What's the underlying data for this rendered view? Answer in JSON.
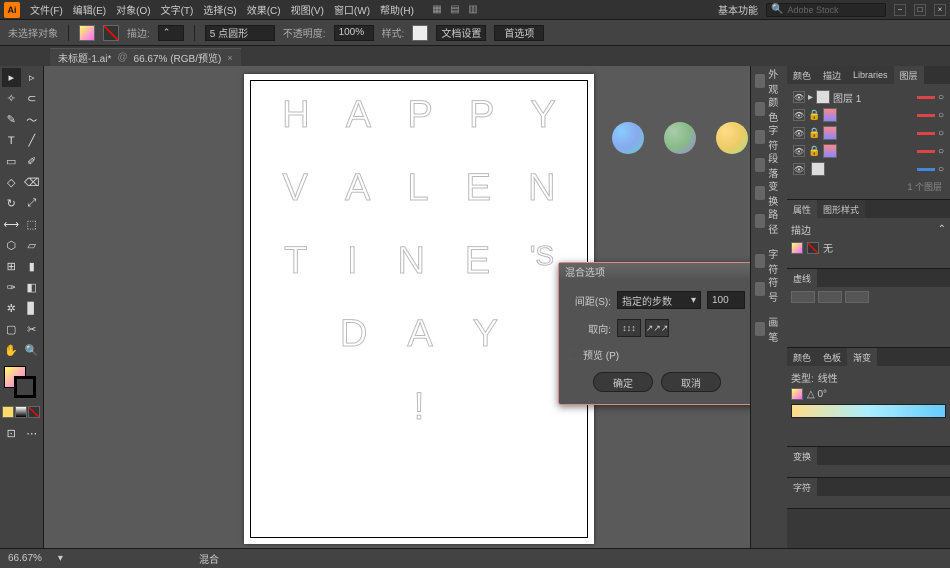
{
  "app": {
    "logo": "Ai",
    "search_placeholder": "Adobe Stock"
  },
  "menu": [
    "文件(F)",
    "编辑(E)",
    "对象(O)",
    "文字(T)",
    "选择(S)",
    "效果(C)",
    "视图(V)",
    "窗口(W)",
    "帮助(H)"
  ],
  "essentials": "基本功能",
  "control": {
    "no_selection": "未选择对象",
    "stroke_label": "描边:",
    "stroke_pt": "5 点圆形",
    "opacity_label": "不透明度:",
    "opacity": "100%",
    "style_label": "样式:",
    "docsetup": "文档设置",
    "prefs": "首选项"
  },
  "doc": {
    "tab": "未标题-1.ai*",
    "zoom": "66.67% (RGB/预览)"
  },
  "artboard": {
    "rows": [
      [
        "H",
        "A",
        "P",
        "P",
        "Y"
      ],
      [
        "V",
        "A",
        "L",
        "E",
        "N"
      ],
      [
        "T",
        "I",
        "N",
        "E",
        "'S"
      ],
      [
        "D",
        "A",
        "Y"
      ],
      [
        "!"
      ]
    ]
  },
  "dialog": {
    "title": "混合选项",
    "spacing_label": "间距(S):",
    "spacing_mode": "指定的步数",
    "steps": "100",
    "orient_label": "取向:",
    "preview": "预览 (P)",
    "ok": "确定",
    "cancel": "取消"
  },
  "dock_icons": [
    "外观",
    "颜色",
    "字符",
    "段落",
    "变换",
    "路径",
    "字符",
    "符号"
  ],
  "brush_label": "画笔",
  "panels": {
    "layers": {
      "tabs": [
        "颜色",
        "描边",
        "Libraries",
        "图层"
      ],
      "items": [
        {
          "name": "图层 1",
          "color": "red"
        },
        {
          "name": "",
          "color": "red"
        },
        {
          "name": "",
          "color": "red"
        },
        {
          "name": "",
          "color": "red"
        },
        {
          "name": "",
          "color": "blue"
        },
        {
          "name": "",
          "color": "blue"
        }
      ],
      "footer": "1 个图层"
    },
    "appearance": {
      "tabs": [
        "属性",
        "图形样式"
      ],
      "stroke": "描边",
      "none": "无"
    },
    "dash": {
      "tab": "虚线"
    },
    "gradient": {
      "tabs": [
        "颜色",
        "色板",
        "渐变"
      ],
      "type": "类型:",
      "linear": "线性"
    },
    "transform": {
      "tab": "变换"
    },
    "char": {
      "tab": "字符"
    }
  },
  "status": {
    "zoom": "66.67%",
    "mode": "混合"
  }
}
